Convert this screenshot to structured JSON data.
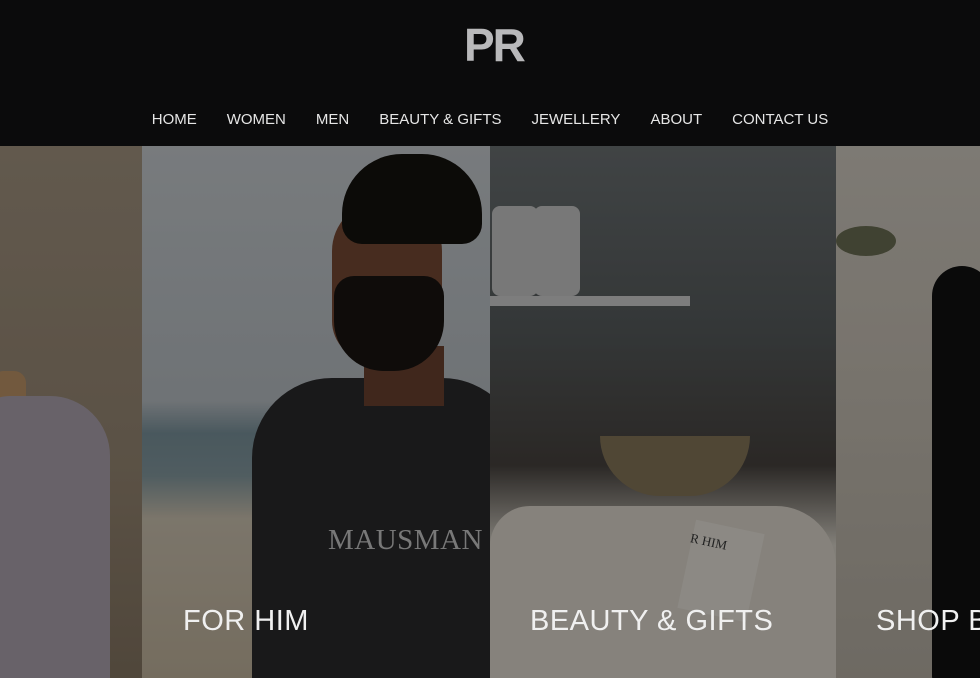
{
  "header": {
    "logo": "PR",
    "nav": [
      "HOME",
      "WOMEN",
      "MEN",
      "BEAUTY & GIFTS",
      "JEWELLERY",
      "ABOUT",
      "CONTACT US"
    ]
  },
  "hero": {
    "panels": [
      {
        "label": ""
      },
      {
        "label": "FOR HIM",
        "shirt_text": "MAUSMAN"
      },
      {
        "label": "BEAUTY & GIFTS",
        "tag_text": "R HIM"
      },
      {
        "label": "SHOP B"
      }
    ]
  }
}
